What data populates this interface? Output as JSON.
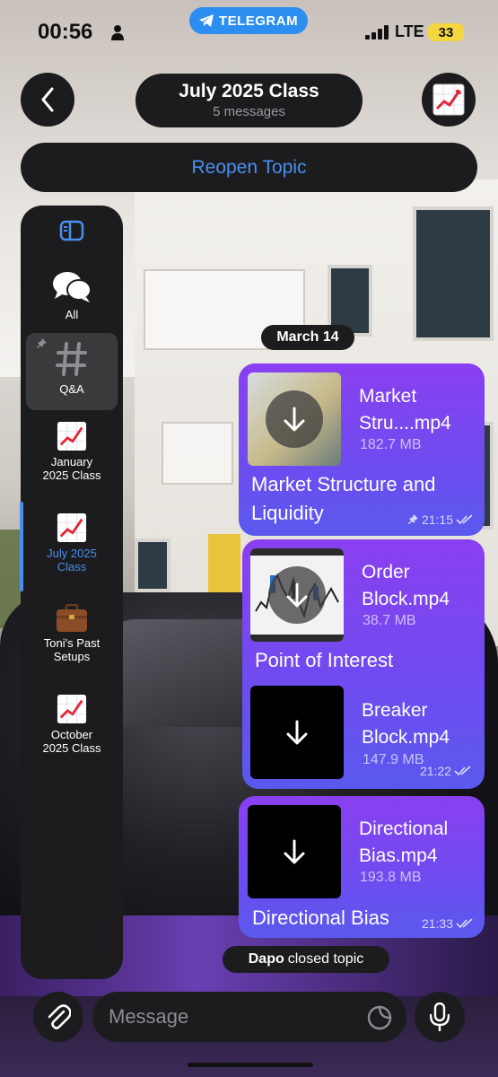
{
  "status_bar": {
    "time": "00:56",
    "app_pill": "TELEGRAM",
    "network": "LTE",
    "battery": "33"
  },
  "header": {
    "title": "July 2025 Class",
    "subtitle": "5 messages",
    "reopen_label": "Reopen Topic"
  },
  "sidebar": {
    "items": [
      {
        "label": "All",
        "icon": "speech-bubbles-icon"
      },
      {
        "label": "Q&A",
        "icon": "hash-icon",
        "pinned": true
      },
      {
        "label": "January\n2025 Class",
        "icon": "chart-increasing-icon"
      },
      {
        "label": "July 2025\nClass",
        "icon": "chart-increasing-icon",
        "active": true
      },
      {
        "label": "Toni's Past\nSetups",
        "icon": "briefcase-icon"
      },
      {
        "label": "October\n2025 Class",
        "icon": "chart-increasing-icon"
      }
    ]
  },
  "date_label": "March 14",
  "messages": [
    {
      "file_name_line1": "Market",
      "file_name_line2": "Stru....mp4",
      "file_size": "182.7 MB",
      "caption": "Market Structure and Liquidity",
      "caption_line1": "Market Structure and",
      "caption_line2": "Liquidity",
      "time": "21:15",
      "pinned": true
    },
    {
      "file_name_line1": "Order",
      "file_name_line2": "Block.mp4",
      "file_size": "38.7 MB",
      "caption": "Point of Interest"
    },
    {
      "file_name_line1": "Breaker",
      "file_name_line2": "Block.mp4",
      "file_size": "147.9 MB",
      "time": "21:22"
    },
    {
      "file_name_line1": "Directional",
      "file_name_line2": "Bias.mp4",
      "file_size": "193.8 MB",
      "caption": "Directional Bias",
      "time": "21:33"
    }
  ],
  "system_message": {
    "actor": "Dapo",
    "action": "closed topic"
  },
  "composer": {
    "placeholder": "Message"
  },
  "colors": {
    "accent": "#4a8ff0",
    "bubble_top": "#8a3ff0",
    "bubble_bottom": "#5a59ee",
    "panel": "#1c1c1e"
  }
}
